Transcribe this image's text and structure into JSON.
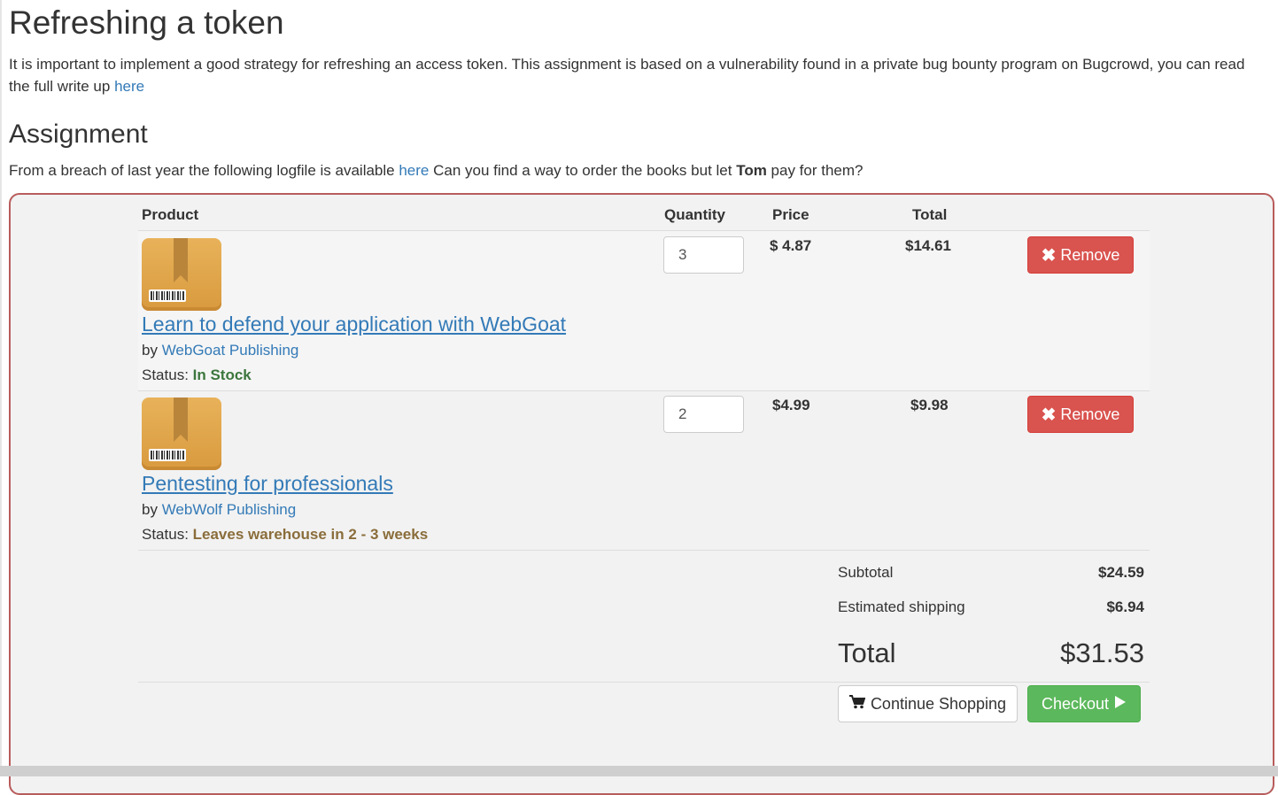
{
  "page": {
    "title": "Refreshing a token",
    "intro_text": "It is important to implement a good strategy for refreshing an access token. This assignment is based on a vulnerability found in a private bug bounty program on Bugcrowd, you can read the full write up ",
    "intro_link": "here"
  },
  "assignment": {
    "heading": "Assignment",
    "text_before": "From a breach of last year the following logfile is available ",
    "log_link": "here",
    "text_middle": " Can you find a way to order the books but let ",
    "user": "Tom",
    "text_after": " pay for them?"
  },
  "cart": {
    "headers": {
      "product": "Product",
      "quantity": "Quantity",
      "price": "Price",
      "total": "Total"
    },
    "items": [
      {
        "title": "Learn to defend your application with WebGoat",
        "by_label": "by ",
        "publisher": "WebGoat Publishing",
        "status_label": "Status: ",
        "status": "In Stock",
        "quantity": "3",
        "price": "$ 4.87",
        "total": "$14.61",
        "remove_label": "Remove",
        "icon": "package-box-icon"
      },
      {
        "title": "Pentesting for professionals",
        "by_label": "by ",
        "publisher": "WebWolf Publishing",
        "status_label": "Status: ",
        "status": "Leaves warehouse in 2 - 3 weeks",
        "quantity": "2",
        "price": "$4.99",
        "total": "$9.98",
        "remove_label": "Remove",
        "icon": "package-box-icon"
      }
    ],
    "summary": {
      "subtotal_label": "Subtotal",
      "subtotal": "$24.59",
      "shipping_label": "Estimated shipping",
      "shipping": "$6.94",
      "total_label": "Total",
      "total": "$31.53"
    },
    "actions": {
      "continue_label": "Continue Shopping",
      "checkout_label": "Checkout"
    }
  },
  "colors": {
    "link": "#337ab7",
    "remove": "#d9534f",
    "checkout": "#5cb85c",
    "border": "#b95c5c",
    "in_stock": "#3c763d",
    "warehouse": "#8a6d3b"
  }
}
